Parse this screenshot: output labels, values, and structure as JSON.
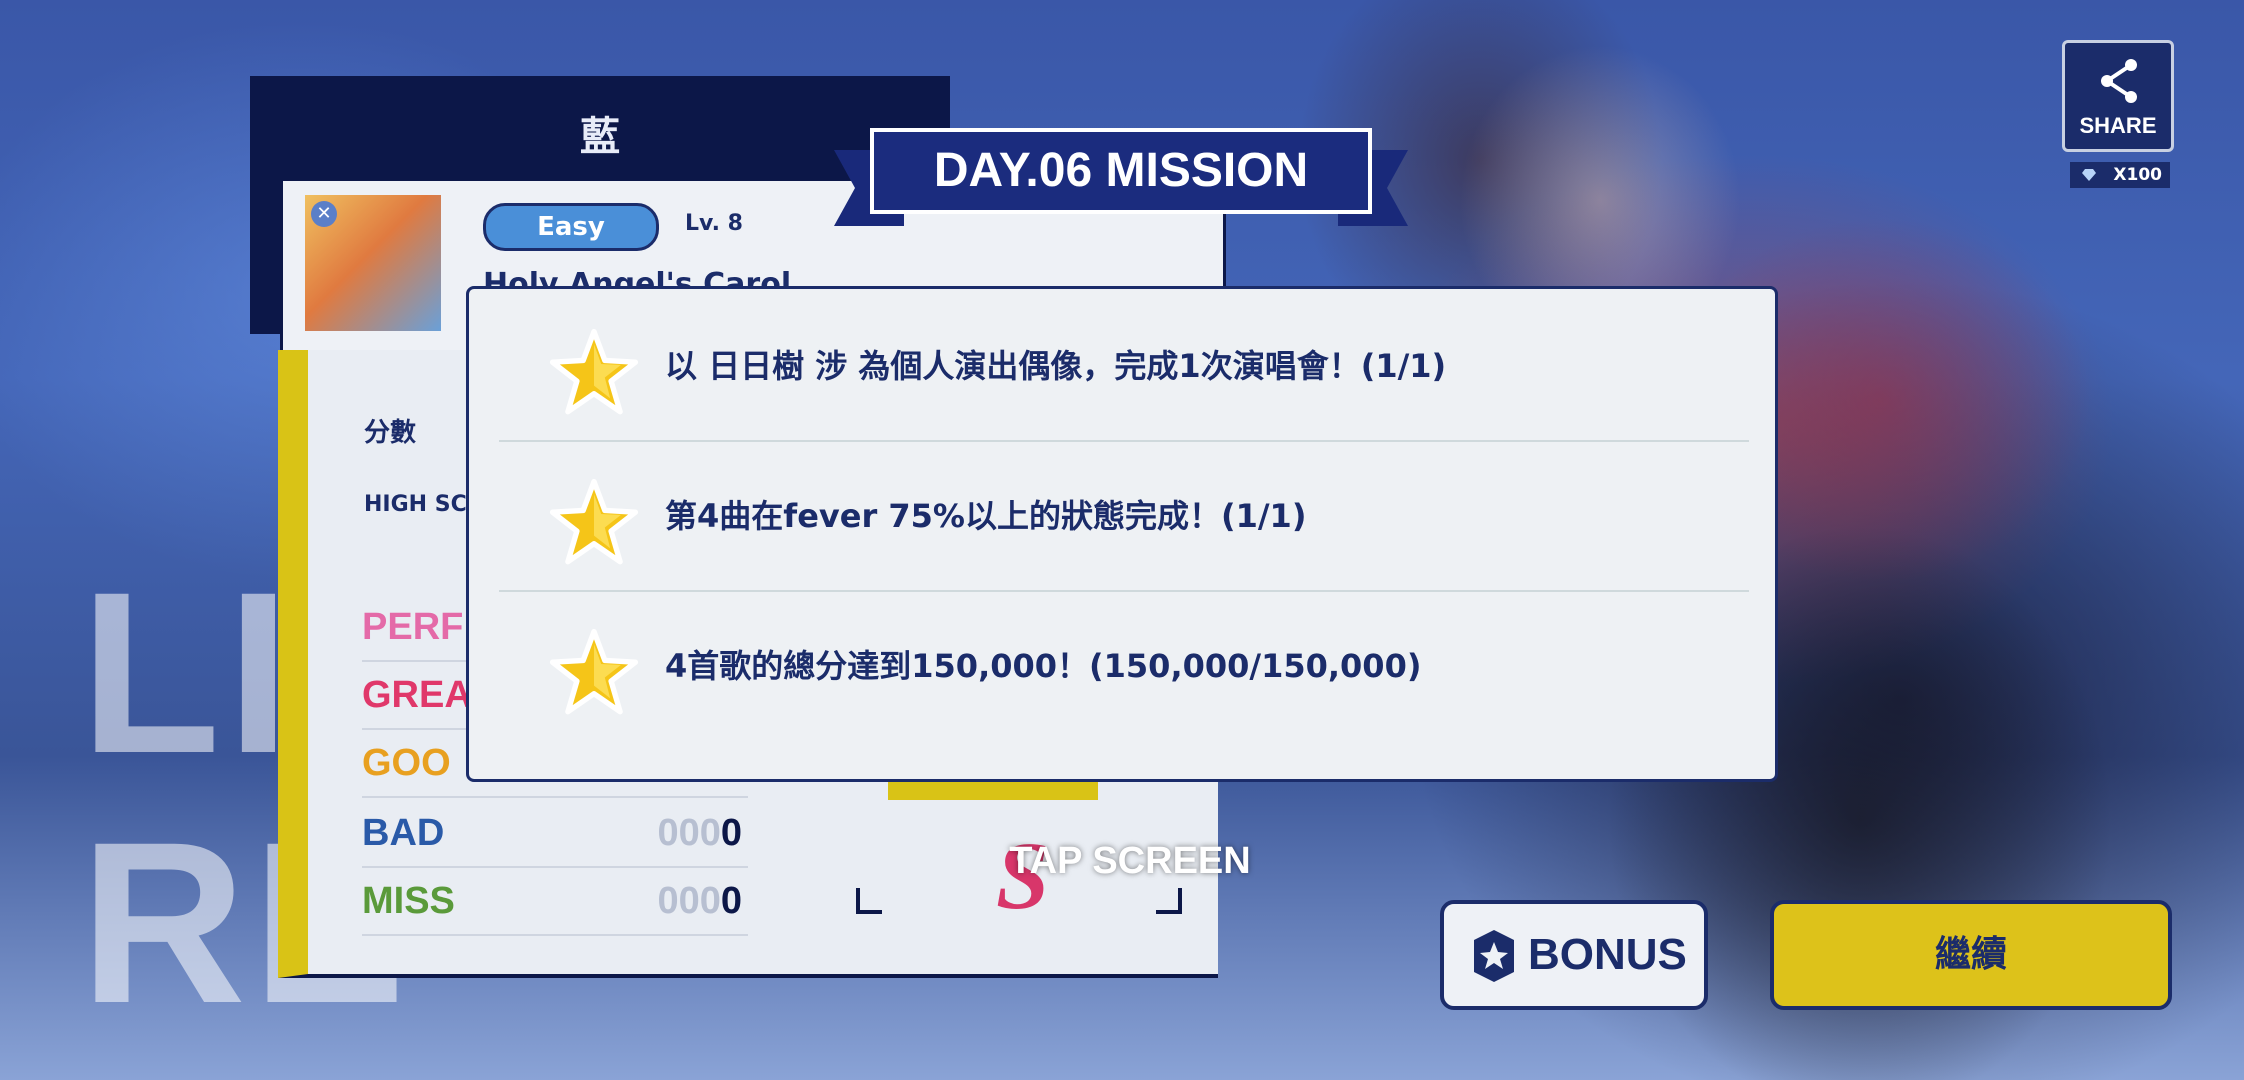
{
  "background": {
    "big_text_line1": "LI",
    "big_text_line2": "RE"
  },
  "result": {
    "unit_name": "藍",
    "difficulty": "Easy",
    "level": "Lv. 8",
    "song_title": "Holy Angel's Carol",
    "score_label": "分數",
    "high_score_label": "HIGH SCO",
    "judgements": [
      {
        "name": "PERF",
        "color": "#e46aa8",
        "zeros": "",
        "value": ""
      },
      {
        "name": "GREA",
        "color": "#e0386a",
        "zeros": "",
        "value": ""
      },
      {
        "name": "GOO",
        "color": "#e8a020",
        "zeros": "",
        "value": ""
      },
      {
        "name": "BAD",
        "color": "#2a5aa8",
        "zeros": "000",
        "value": "0"
      },
      {
        "name": "MISS",
        "color": "#5a9a3a",
        "zeros": "000",
        "value": "0"
      }
    ],
    "rank": "S"
  },
  "mission": {
    "banner_title": "DAY.06 MISSION",
    "items": [
      {
        "text": "以 日日樹 涉 為個人演出偶像，完成1次演唱會！(1/1)",
        "icon": "star-icon"
      },
      {
        "text": "第4曲在fever 75%以上的狀態完成！(1/1)",
        "icon": "star-icon"
      },
      {
        "text": "4首歌的總分達到150,000！(150,000/150,000)",
        "icon": "star-icon"
      }
    ]
  },
  "share": {
    "label": "SHARE",
    "cost": "X100"
  },
  "tap_screen": "TAP SCREEN",
  "bonus_button": "BONUS",
  "continue_button": "繼續",
  "colors": {
    "navy": "#1b2c6a",
    "accent_yellow": "#ddc21a",
    "panel": "#eef1f4"
  }
}
